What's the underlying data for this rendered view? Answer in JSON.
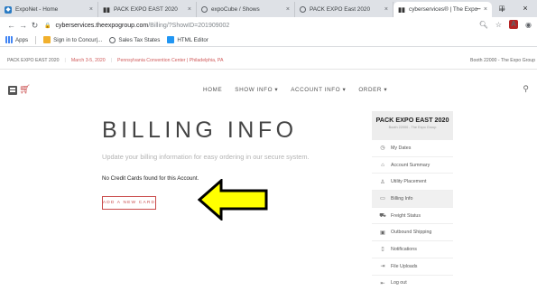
{
  "browser": {
    "tabs": [
      {
        "title": "ExpoNet - Home",
        "icon": "exponet-icon"
      },
      {
        "title": "PACK EXPO EAST 2020",
        "icon": "packexpo-icon"
      },
      {
        "title": "expoCube / Shows",
        "icon": "globe-icon"
      },
      {
        "title": "PACK EXPO East 2020",
        "icon": "globe-icon"
      },
      {
        "title": "cyberservices® | The Expo",
        "icon": "packexpo-icon"
      }
    ],
    "close_glyph": "×",
    "new_tab_glyph": "+",
    "window_controls": [
      "–",
      "□",
      "×"
    ],
    "url_host": "cyberservices.theexpogroup.com",
    "url_path": "/Billing/?ShowID=201909002",
    "bookmarks": [
      {
        "label": "Apps",
        "icon": "apps-icon"
      },
      {
        "label": "Sign in to Concur|...",
        "icon": "concur-icon"
      },
      {
        "label": "Sales Tax States",
        "icon": "globe-icon"
      },
      {
        "label": "HTML Editor",
        "icon": "html-icon"
      }
    ]
  },
  "infostrip": {
    "show": "PACK EXPO EAST 2020",
    "dates": "March 3-5, 2020",
    "location": "Pennsylvania Convention Center | Philadelphia, PA",
    "booth": "Booth 22000 - The Expo Group"
  },
  "nav": {
    "items": [
      "HOME",
      "SHOW INFO ▾",
      "ACCOUNT INFO ▾",
      "ORDER ▾"
    ]
  },
  "main": {
    "title": "BILLING INFO",
    "subtitle": "Update your billing information for easy ordering in our secure system.",
    "empty_message": "No Credit Cards found for this Account.",
    "add_card_label": "ADD A NEW CARD"
  },
  "sidebar": {
    "title": "PACK EXPO EAST 2020",
    "subtitle": "Booth 22000 - The Expo Group",
    "items": [
      {
        "label": "My Dates",
        "icon": "clock-icon"
      },
      {
        "label": "Account Summary",
        "icon": "account-icon"
      },
      {
        "label": "Utility Placement",
        "icon": "utility-icon"
      },
      {
        "label": "Billing Info",
        "icon": "card-icon",
        "active": true
      },
      {
        "label": "Freight Status",
        "icon": "truck-icon"
      },
      {
        "label": "Outbound Shipping",
        "icon": "box-icon"
      },
      {
        "label": "Notifications",
        "icon": "bell-icon"
      },
      {
        "label": "File Uploads",
        "icon": "upload-icon"
      },
      {
        "label": "Log out",
        "icon": "logout-icon"
      }
    ]
  },
  "colors": {
    "accent": "#c94a4a",
    "arrow_fill": "#ffff00"
  }
}
